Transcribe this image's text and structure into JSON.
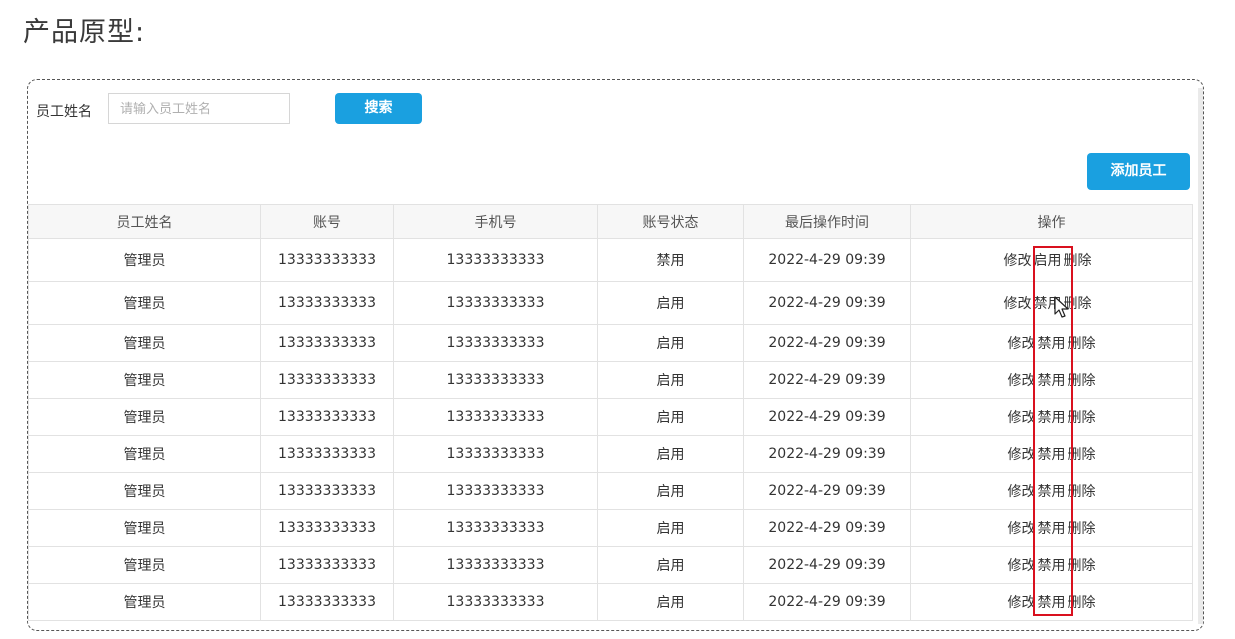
{
  "heading": "产品原型:",
  "search": {
    "label": "员工姓名",
    "placeholder": "请输入员工姓名",
    "button": "搜索"
  },
  "add_button": "添加员工",
  "columns": [
    "员工姓名",
    "账号",
    "手机号",
    "账号状态",
    "最后操作时间",
    "操作"
  ],
  "rows": [
    {
      "name": "管理员",
      "account": "13333333333",
      "phone": "13333333333",
      "status": "禁用",
      "time": "2022-4-29 09:39",
      "edit": "修改",
      "toggle": "启用",
      "delete": "删除"
    },
    {
      "name": "管理员",
      "account": "13333333333",
      "phone": "13333333333",
      "status": "启用",
      "time": "2022-4-29 09:39",
      "edit": "修改",
      "toggle": "禁用",
      "delete": "删除"
    },
    {
      "name": "管理员",
      "account": "13333333333",
      "phone": "13333333333",
      "status": "启用",
      "time": "2022-4-29 09:39",
      "edit": "修改",
      "toggle": "禁用",
      "delete": "删除"
    },
    {
      "name": "管理员",
      "account": "13333333333",
      "phone": "13333333333",
      "status": "启用",
      "time": "2022-4-29 09:39",
      "edit": "修改",
      "toggle": "禁用",
      "delete": "删除"
    },
    {
      "name": "管理员",
      "account": "13333333333",
      "phone": "13333333333",
      "status": "启用",
      "time": "2022-4-29 09:39",
      "edit": "修改",
      "toggle": "禁用",
      "delete": "删除"
    },
    {
      "name": "管理员",
      "account": "13333333333",
      "phone": "13333333333",
      "status": "启用",
      "time": "2022-4-29 09:39",
      "edit": "修改",
      "toggle": "禁用",
      "delete": "删除"
    },
    {
      "name": "管理员",
      "account": "13333333333",
      "phone": "13333333333",
      "status": "启用",
      "time": "2022-4-29 09:39",
      "edit": "修改",
      "toggle": "禁用",
      "delete": "删除"
    },
    {
      "name": "管理员",
      "account": "13333333333",
      "phone": "13333333333",
      "status": "启用",
      "time": "2022-4-29 09:39",
      "edit": "修改",
      "toggle": "禁用",
      "delete": "删除"
    },
    {
      "name": "管理员",
      "account": "13333333333",
      "phone": "13333333333",
      "status": "启用",
      "time": "2022-4-29 09:39",
      "edit": "修改",
      "toggle": "禁用",
      "delete": "删除"
    },
    {
      "name": "管理员",
      "account": "13333333333",
      "phone": "13333333333",
      "status": "启用",
      "time": "2022-4-29 09:39",
      "edit": "修改",
      "toggle": "禁用",
      "delete": "删除"
    }
  ],
  "highlight_color": "#d9101e",
  "accent_color": "#1aa0e0"
}
